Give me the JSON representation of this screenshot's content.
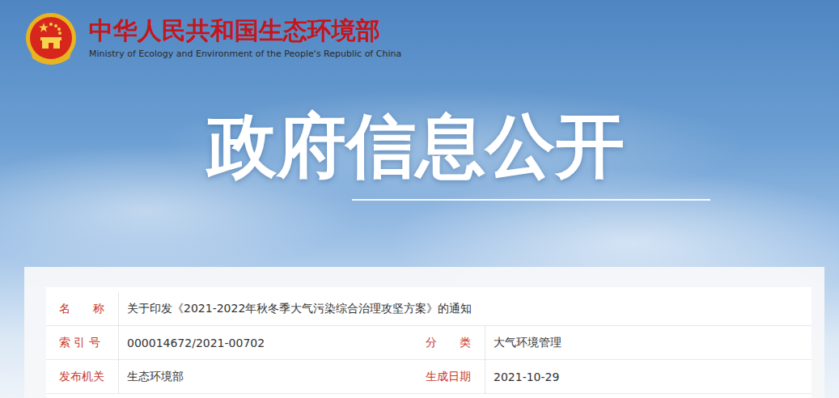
{
  "header": {
    "title": "中华人民共和国生态环境部",
    "subtitle": "Ministry of Ecology and Environment of the People's Republic of China"
  },
  "banner": {
    "title": "政府信息公开"
  },
  "info_table": {
    "rows": [
      {
        "cells": [
          {
            "label": "名　　称",
            "value": "关于印发《2021-2022年秋冬季大气污染综合治理攻坚方案》的通知"
          }
        ]
      },
      {
        "cells": [
          {
            "label": "索 引 号",
            "value": "000014672/2021-00702"
          },
          {
            "label": "分　　类",
            "value": "大气环境管理"
          }
        ]
      },
      {
        "cells": [
          {
            "label": "发布机关",
            "value": "生态环境部"
          },
          {
            "label": "生成日期",
            "value": "2021-10-29"
          }
        ]
      }
    ]
  }
}
